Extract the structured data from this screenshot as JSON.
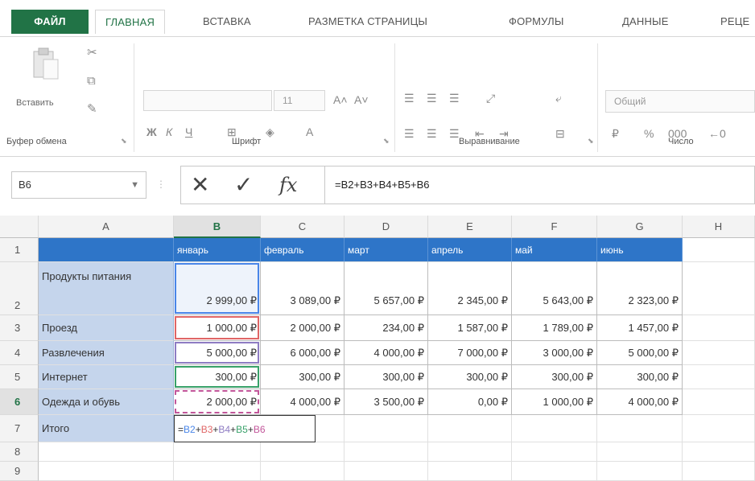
{
  "ribbon_tabs": [
    "ФАЙЛ",
    "ГЛАВНАЯ",
    "ВСТАВКА",
    "РАЗМЕТКА СТРАНИЦЫ",
    "ФОРМУЛЫ",
    "ДАННЫЕ",
    "РЕЦЕ"
  ],
  "ribbon": {
    "paste_label": "Вставить",
    "font_size": "11",
    "number_format": "Общий",
    "groups": [
      "Буфер обмена",
      "Шрифт",
      "Выравнивание",
      "Число"
    ]
  },
  "formula_bar": {
    "name_box": "B6",
    "formula": "=B2+B3+B4+B5+B6"
  },
  "columns": [
    "A",
    "B",
    "C",
    "D",
    "E",
    "F",
    "G",
    "H"
  ],
  "rows": [
    "1",
    "2",
    "3",
    "4",
    "5",
    "6",
    "7",
    "8",
    "9"
  ],
  "table": {
    "months": [
      "январь",
      "февраль",
      "март",
      "апрель",
      "май",
      "июнь"
    ],
    "categories": [
      "Продукты питания",
      "Проезд",
      "Развлечения",
      "Интернет",
      "Одежда и обувь"
    ],
    "values": [
      [
        "2 999,00 ₽",
        "3 089,00 ₽",
        "5 657,00 ₽",
        "2 345,00 ₽",
        "5 643,00 ₽",
        "2 323,00 ₽"
      ],
      [
        "1 000,00 ₽",
        "2 000,00 ₽",
        "234,00 ₽",
        "1 587,00 ₽",
        "1 789,00 ₽",
        "1 457,00 ₽"
      ],
      [
        "5 000,00 ₽",
        "6 000,00 ₽",
        "4 000,00 ₽",
        "7 000,00 ₽",
        "3 000,00 ₽",
        "5 000,00 ₽"
      ],
      [
        "300,00 ₽",
        "300,00 ₽",
        "300,00 ₽",
        "300,00 ₽",
        "300,00 ₽",
        "300,00 ₽"
      ],
      [
        "2 000,00 ₽",
        "4 000,00 ₽",
        "3 500,00 ₽",
        "0,00 ₽",
        "1 000,00 ₽",
        "4 000,00 ₽"
      ]
    ],
    "total_label": "Итого",
    "formula_parts": [
      {
        "text": "=",
        "color": "#333333"
      },
      {
        "text": "B2",
        "color": "#4a86e8"
      },
      {
        "text": "+",
        "color": "#333333"
      },
      {
        "text": "B3",
        "color": "#e06666"
      },
      {
        "text": "+",
        "color": "#333333"
      },
      {
        "text": "B4",
        "color": "#8e7cc3"
      },
      {
        "text": "+",
        "color": "#333333"
      },
      {
        "text": "B5",
        "color": "#38a169"
      },
      {
        "text": "+",
        "color": "#333333"
      },
      {
        "text": "B6",
        "color": "#c2569a"
      }
    ]
  },
  "colors": {
    "accent": "#217346",
    "header_fill": "#2e75c8",
    "label_fill": "#c5d5ec"
  }
}
